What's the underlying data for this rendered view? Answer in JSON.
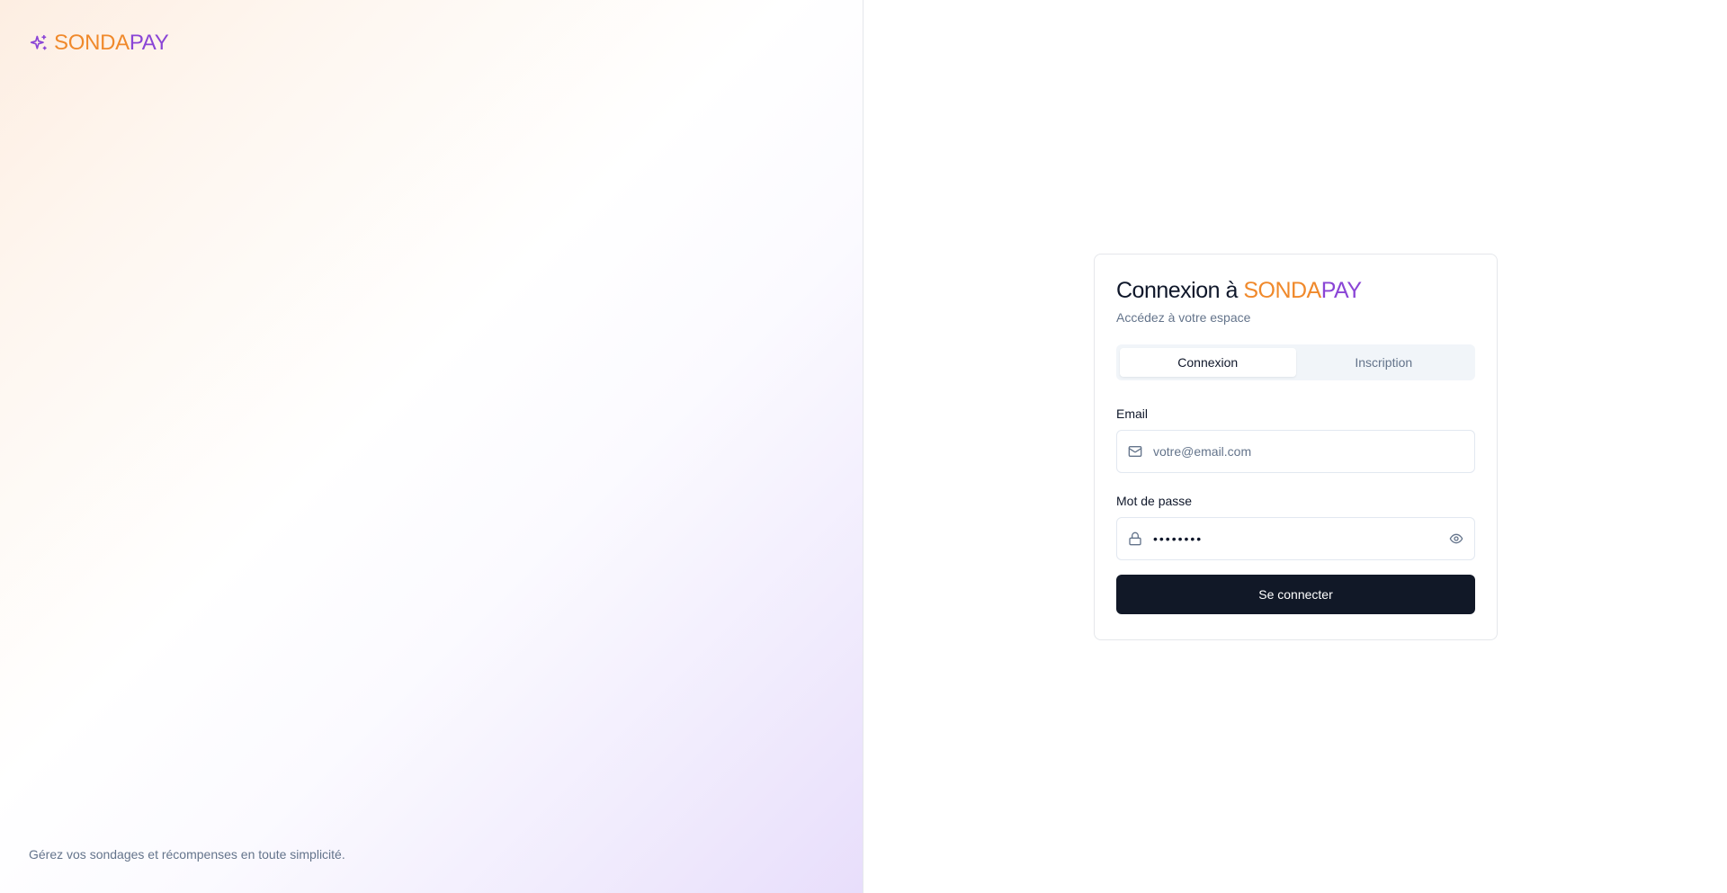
{
  "brand": {
    "name_part_a": "SONDA",
    "name_part_b": "PAY",
    "icon": "sparkles-icon",
    "tagline": "Gérez vos sondages et récompenses en toute simplicité."
  },
  "colors": {
    "brand_orange": "#f0892b",
    "brand_purple": "#8a45d6",
    "button_dark": "#111827"
  },
  "card": {
    "title_prefix": "Connexion à ",
    "title_brand_a": "SONDA",
    "title_brand_b": "PAY",
    "subtitle": "Accédez à votre espace"
  },
  "tabs": [
    {
      "label": "Connexion",
      "active": true
    },
    {
      "label": "Inscription",
      "active": false
    }
  ],
  "form": {
    "email": {
      "label": "Email",
      "value": "",
      "placeholder": "votre@email.com",
      "icon": "mail-icon"
    },
    "password": {
      "label": "Mot de passe",
      "value": "••••••••",
      "icon": "lock-icon",
      "toggle_icon": "eye-icon"
    },
    "submit_label": "Se connecter"
  }
}
